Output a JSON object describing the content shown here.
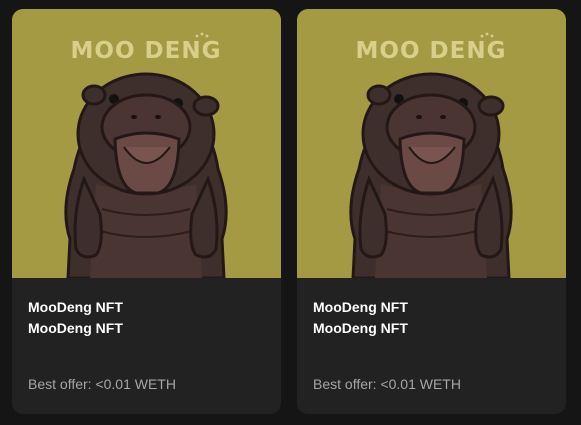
{
  "colors": {
    "page_background": "#151515",
    "card_background": "#222223",
    "media_background": "#a59a44",
    "title_text": "#ffffff",
    "secondary_text": "#a6a6a6"
  },
  "cards": [
    {
      "image_alt": "moodeng-hippo-illustration",
      "image_lettering": "MOO DENG",
      "name": "MooDeng NFT",
      "collection": "MooDeng NFT",
      "offer": "Best offer: <0.01 WETH"
    },
    {
      "image_alt": "moodeng-hippo-illustration",
      "image_lettering": "MOO DENG",
      "name": "MooDeng NFT",
      "collection": "MooDeng NFT",
      "offer": "Best offer: <0.01 WETH"
    }
  ]
}
